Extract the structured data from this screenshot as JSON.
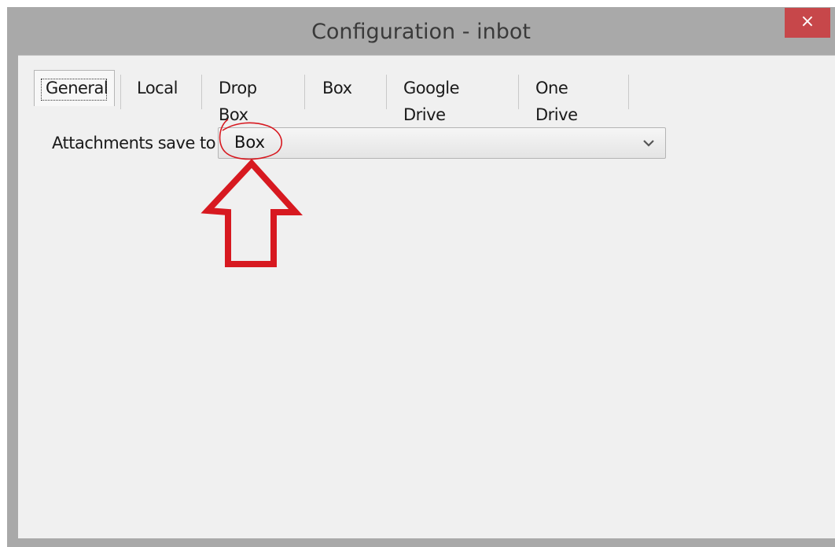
{
  "window": {
    "title": "Configuration - inbot",
    "close_glyph": "×"
  },
  "tabs": [
    {
      "label": "General",
      "active": true
    },
    {
      "label": "Local",
      "active": false
    },
    {
      "label": "Drop Box",
      "active": false
    },
    {
      "label": "Box",
      "active": false
    },
    {
      "label": "Google Drive",
      "active": false
    },
    {
      "label": "One Drive",
      "active": false
    }
  ],
  "general": {
    "attachments_label": "Attachments save to",
    "attachments_value": "Box",
    "dropdown_icon": "chevron-down-icon"
  },
  "annotation": {
    "color": "#d71920",
    "shapes": [
      "red-circle-highlight",
      "red-up-arrow"
    ]
  },
  "colors": {
    "close_button": "#c7474a",
    "titlebar": "#a9a9a9",
    "client": "#f0f0f0"
  }
}
